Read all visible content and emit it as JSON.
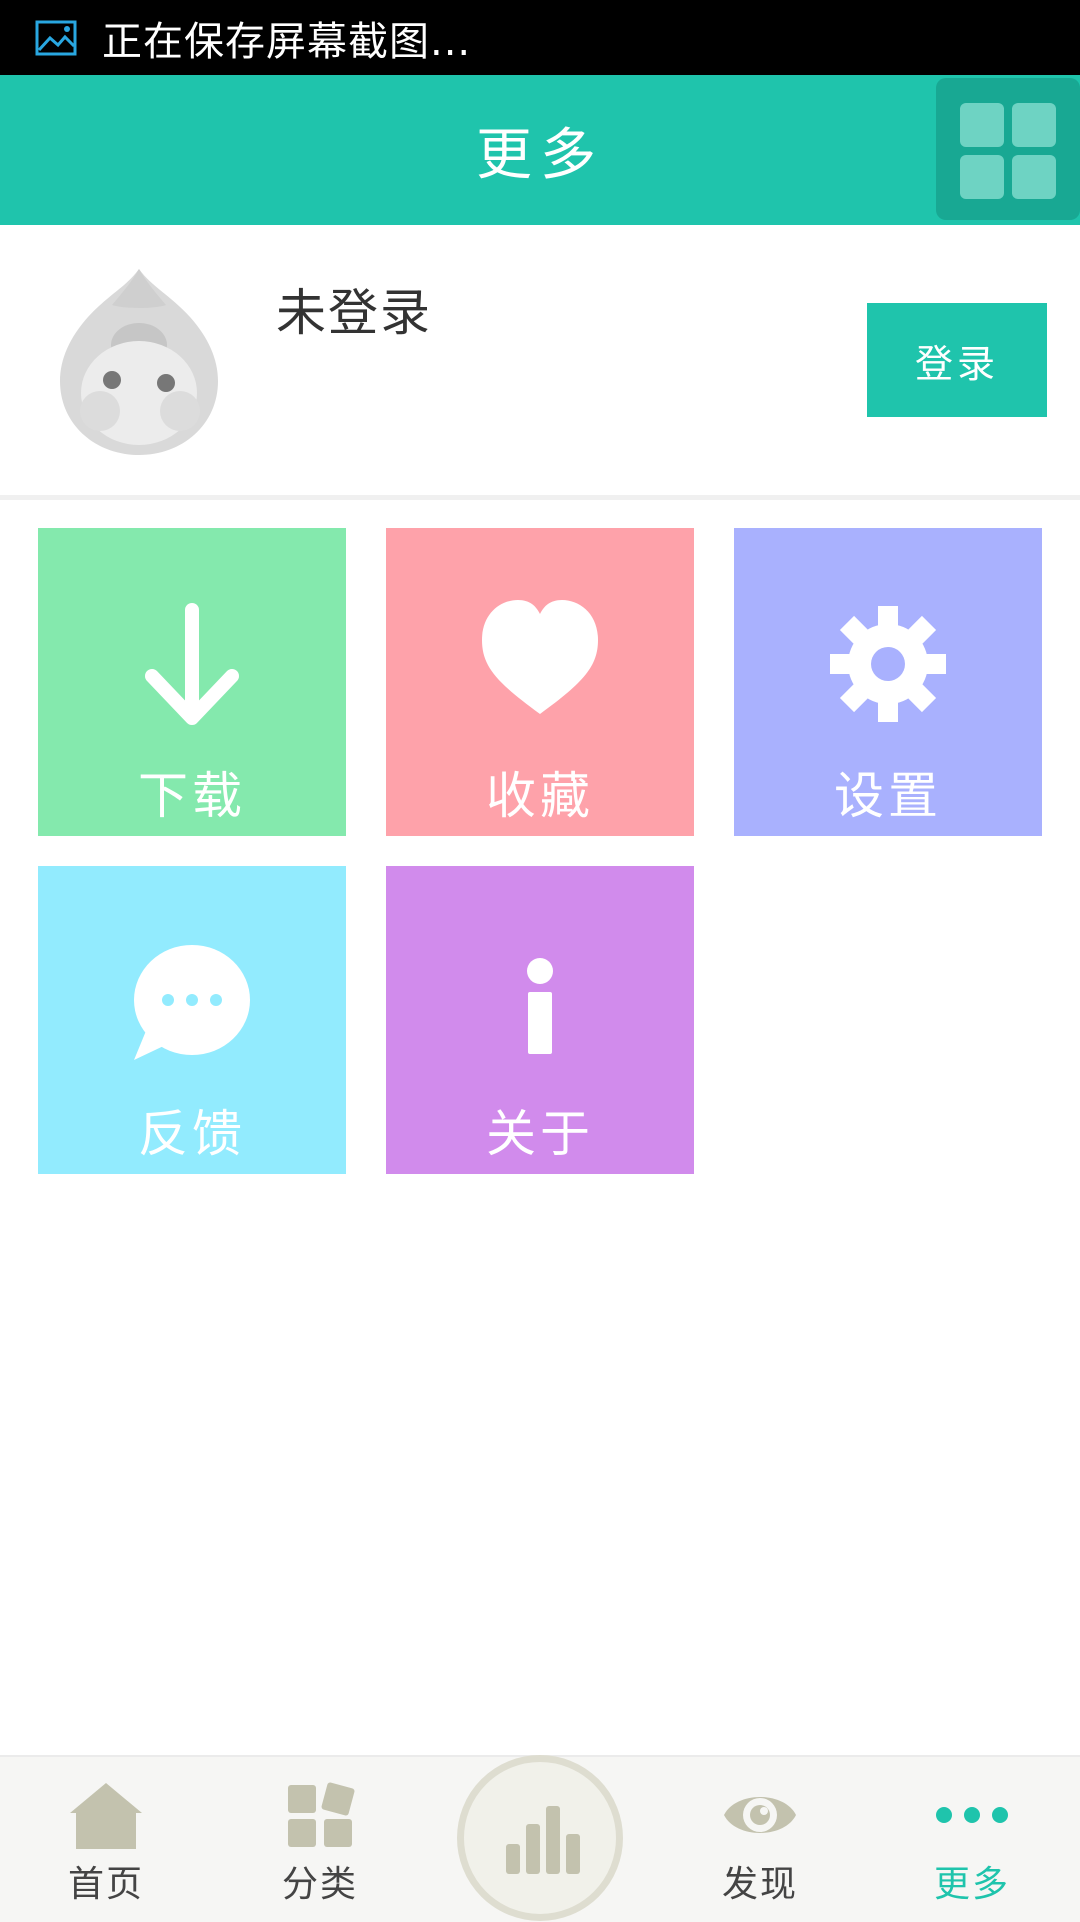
{
  "status_bar": {
    "text": "正在保存屏幕截图...",
    "icon": "image-icon"
  },
  "header": {
    "title": "更多",
    "menu_icon": "grid-icon"
  },
  "profile": {
    "name": "未登录",
    "login_label": "登录",
    "avatar_icon": "droplet-avatar-icon"
  },
  "tiles": [
    {
      "label": "下载",
      "icon": "download-arrow-icon",
      "color": "#84e9ad"
    },
    {
      "label": "收藏",
      "icon": "heart-icon",
      "color": "#fea2aa"
    },
    {
      "label": "设置",
      "icon": "gear-icon",
      "color": "#a9b1fe"
    },
    {
      "label": "反馈",
      "icon": "chat-bubble-icon",
      "color": "#92ebfe"
    },
    {
      "label": "关于",
      "icon": "info-icon",
      "color": "#d18bec"
    }
  ],
  "nav": [
    {
      "label": "首页",
      "icon": "home-icon"
    },
    {
      "label": "分类",
      "icon": "category-icon"
    },
    {
      "label": "",
      "icon": "bar-chart-icon"
    },
    {
      "label": "发现",
      "icon": "eye-icon"
    },
    {
      "label": "更多",
      "icon": "more-dots-icon",
      "active": true
    }
  ],
  "colors": {
    "accent": "#1fc4ac",
    "nav_icon": "#c3c2ae"
  }
}
